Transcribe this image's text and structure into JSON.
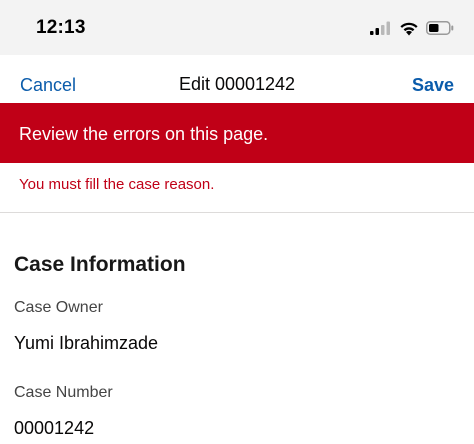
{
  "status_bar": {
    "time": "12:13",
    "icons": [
      "signal-icon",
      "wifi-icon",
      "battery-icon"
    ]
  },
  "nav": {
    "cancel_label": "Cancel",
    "title": "Edit 00001242",
    "save_label": "Save"
  },
  "error_banner": {
    "message": "Review the errors on this page."
  },
  "error_detail": {
    "message": "You must fill the case reason."
  },
  "section": {
    "title": "Case Information",
    "fields": [
      {
        "label": "Case Owner",
        "value": "Yumi Ibrahimzade"
      },
      {
        "label": "Case Number",
        "value": "00001242"
      }
    ]
  },
  "colors": {
    "accent": "#0b5cab",
    "error": "#c00017",
    "status_bar_bg": "#f3f3f3"
  }
}
